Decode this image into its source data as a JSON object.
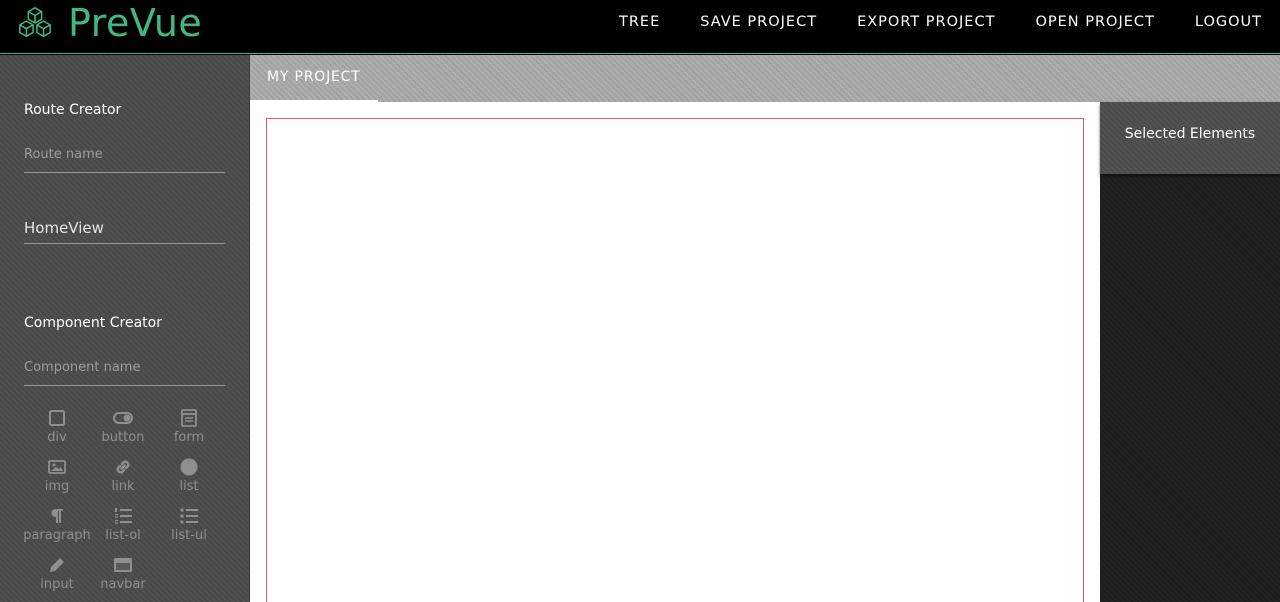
{
  "app": {
    "name": "PreVue",
    "brand_color": "#41b883",
    "logo_icon": "cubes-icon"
  },
  "nav": {
    "items": [
      "TREE",
      "SAVE PROJECT",
      "EXPORT PROJECT",
      "OPEN PROJECT",
      "LOGOUT"
    ]
  },
  "sidebar": {
    "route_creator": {
      "title": "Route Creator",
      "placeholder": "Route name",
      "routes": [
        "HomeView"
      ]
    },
    "component_creator": {
      "title": "Component Creator",
      "placeholder": "Component name",
      "elements": [
        {
          "label": "div",
          "icon": "square-icon"
        },
        {
          "label": "button",
          "icon": "toggle-icon"
        },
        {
          "label": "form",
          "icon": "form-icon"
        },
        {
          "label": "img",
          "icon": "image-icon"
        },
        {
          "label": "link",
          "icon": "link-icon"
        },
        {
          "label": "list",
          "icon": "circle-icon"
        },
        {
          "label": "paragraph",
          "icon": "pilcrow-icon"
        },
        {
          "label": "list-ol",
          "icon": "list-ol-icon"
        },
        {
          "label": "list-ul",
          "icon": "list-ul-icon"
        },
        {
          "label": "input",
          "icon": "pencil-icon"
        },
        {
          "label": "navbar",
          "icon": "navbar-icon"
        }
      ]
    }
  },
  "main": {
    "tabs": [
      {
        "label": "MY PROJECT"
      }
    ]
  },
  "right_panel": {
    "title": "Selected Elements"
  },
  "colors": {
    "canvas_border": "#e35b6e",
    "icon_gray": "#8f8f8f"
  }
}
